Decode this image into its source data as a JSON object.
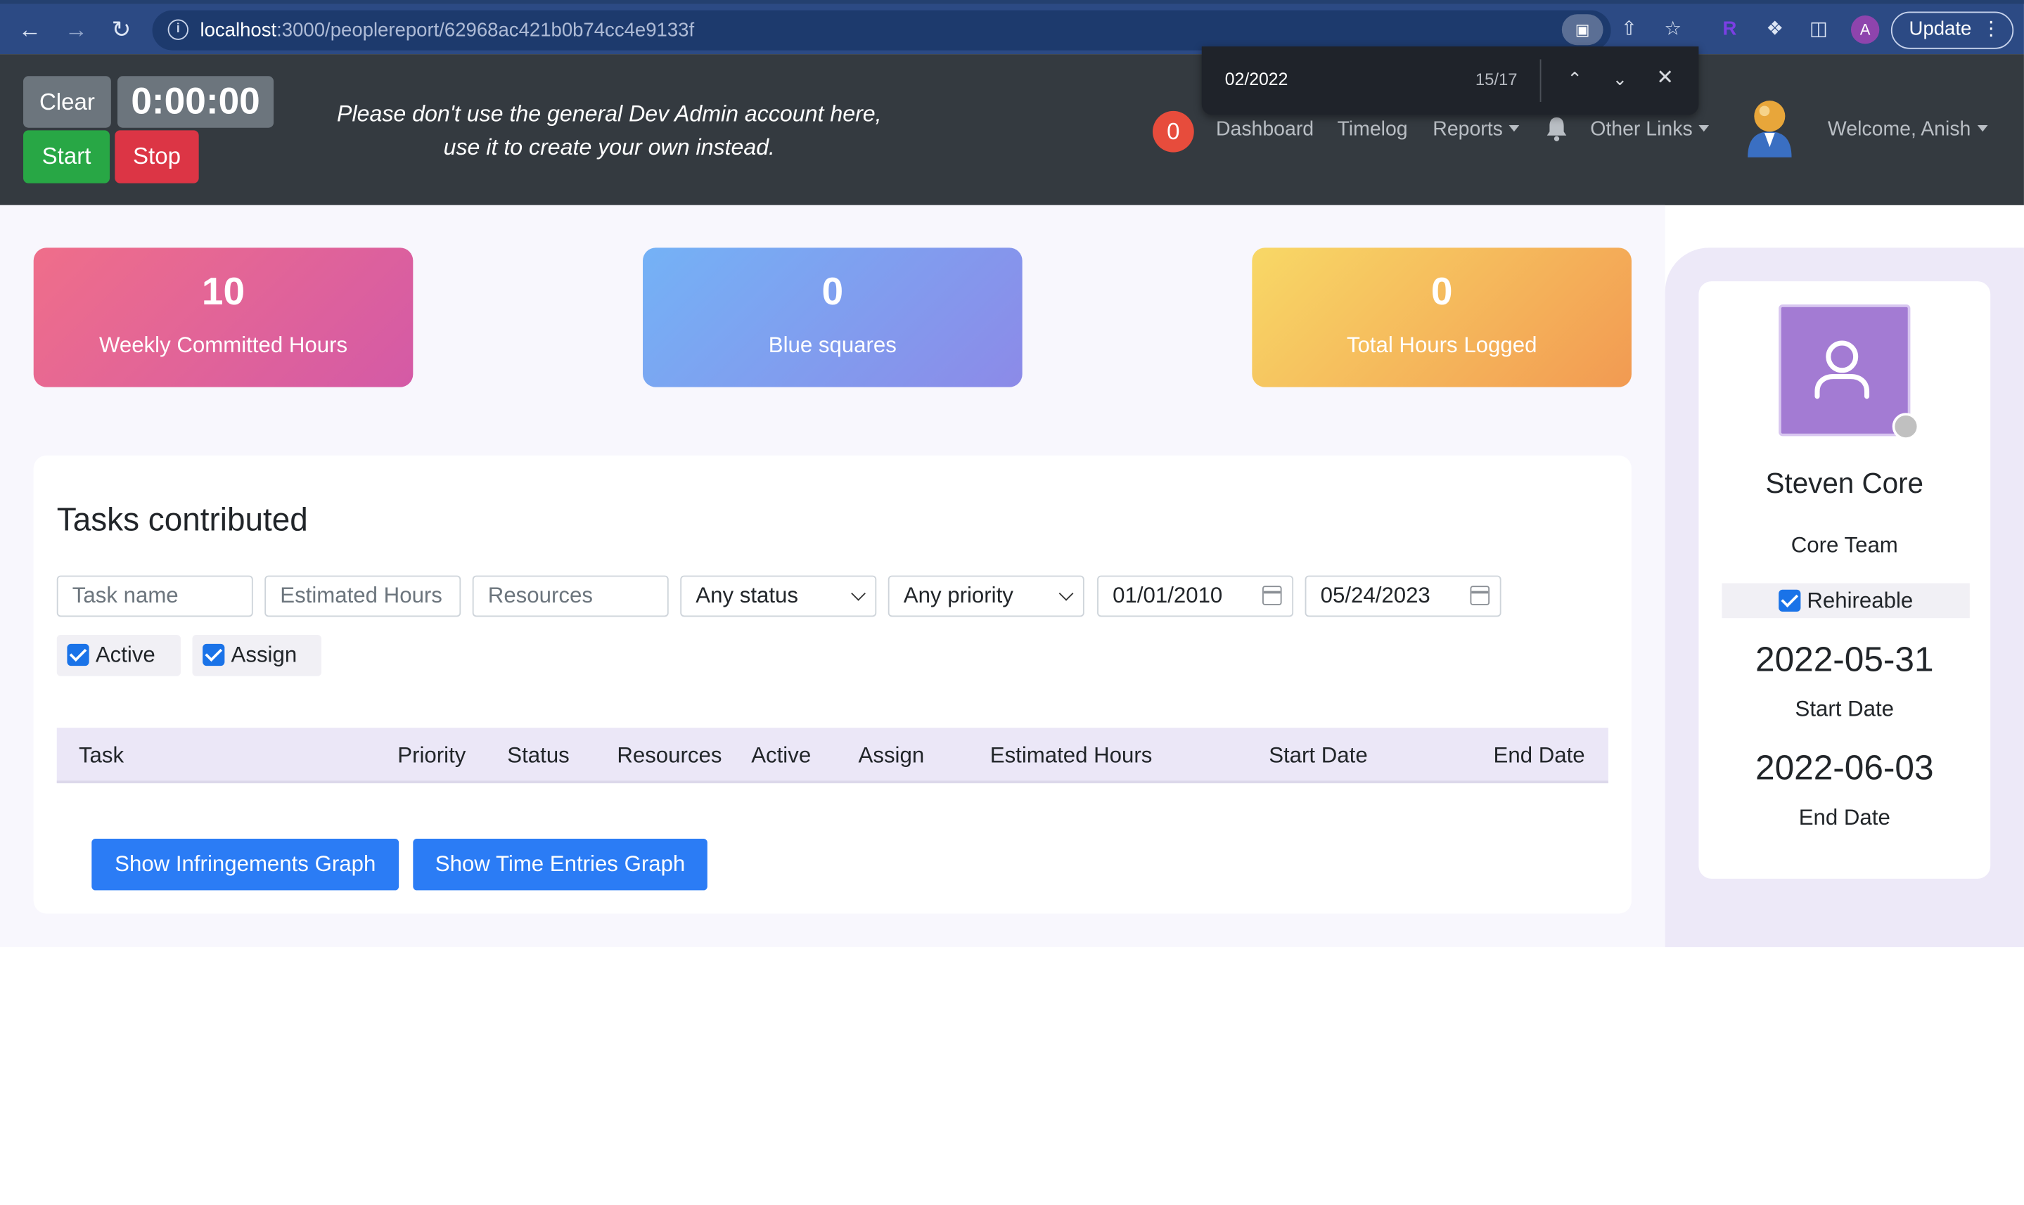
{
  "browser": {
    "url_host": "localhost",
    "url_path": ":3000/peoplereport/62968ac421b0b74cc4e9133f",
    "profile_initial": "A",
    "update_label": "Update"
  },
  "find_bar": {
    "query": "02/2022",
    "count": "15/17"
  },
  "timer": {
    "clear_label": "Clear",
    "time": "0:00:00",
    "start_label": "Start",
    "stop_label": "Stop"
  },
  "header": {
    "warning_line1": "Please don't use the general Dev Admin account here,",
    "warning_line2": "use it to create your own instead.",
    "notification_count": "0",
    "nav": {
      "dashboard": "Dashboard",
      "timelog": "Timelog",
      "reports": "Reports",
      "other_links": "Other Links",
      "welcome": "Welcome, Anish"
    }
  },
  "stats": [
    {
      "value": "10",
      "label": "Weekly Committed Hours"
    },
    {
      "value": "0",
      "label": "Blue squares"
    },
    {
      "value": "0",
      "label": "Total Hours Logged"
    }
  ],
  "tasks": {
    "title": "Tasks contributed",
    "filters": {
      "task_name_placeholder": "Task name",
      "estimated_hours_placeholder": "Estimated Hours",
      "resources_placeholder": "Resources",
      "status": "Any status",
      "priority": "Any priority",
      "start_date": "01/01/2010",
      "end_date": "05/24/2023",
      "active_label": "Active",
      "assign_label": "Assign"
    },
    "columns": [
      "Task",
      "Priority",
      "Status",
      "Resources",
      "Active",
      "Assign",
      "Estimated Hours",
      "Start Date",
      "End Date"
    ],
    "buttons": {
      "infringements": "Show Infringements Graph",
      "time_entries": "Show Time Entries Graph"
    }
  },
  "profile": {
    "name": "Steven Core",
    "team": "Core Team",
    "rehireable_label": "Rehireable",
    "start_date": "2022-05-31",
    "start_date_label": "Start Date",
    "end_date": "2022-06-03",
    "end_date_label": "End Date"
  },
  "colors": {
    "header_bg": "#343a40",
    "primary_blue": "#2b7cf5",
    "success": "#28a745",
    "danger": "#dc3545"
  }
}
